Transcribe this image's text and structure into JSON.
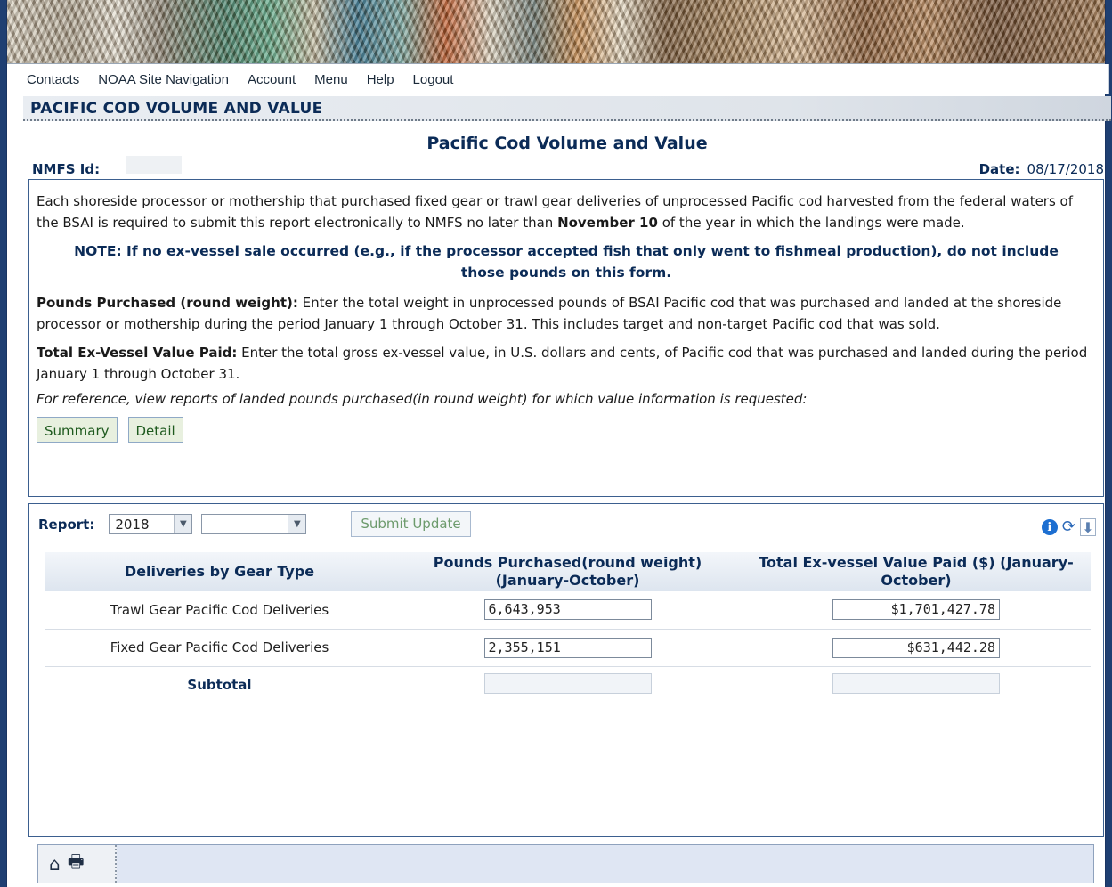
{
  "nav": [
    "Contacts",
    "NOAA Site Navigation",
    "Account",
    "Menu",
    "Help",
    "Logout"
  ],
  "header": {
    "section_title": "PACIFIC COD VOLUME AND VALUE",
    "page_title": "Pacific Cod Volume and Value",
    "nmfs_label": "NMFS Id:",
    "nmfs_value": "",
    "date_label": "Date:",
    "date_value": "08/17/2018"
  },
  "info": {
    "intro_pre": "Each shoreside processor or mothership that purchased fixed gear or trawl gear deliveries of unprocessed Pacific cod harvested from the federal waters of the BSAI is required to submit this report electronically to NMFS no later than ",
    "intro_bold": "November 10",
    "intro_post": " of the year in which the landings were made.",
    "note": "NOTE: If no ex-vessel sale occurred (e.g., if the processor accepted fish that only went to fishmeal production), do not include those pounds on this form.",
    "pounds_label": "Pounds Purchased (round weight):",
    "pounds_text": " Enter the total weight in unprocessed pounds of BSAI Pacific cod that was purchased and landed at the shoreside processor or mothership during the period January 1 through October 31. This includes target and non-target Pacific cod that was sold.",
    "value_label": "Total Ex-Vessel Value Paid:",
    "value_text": " Enter the total gross ex-vessel value, in U.S. dollars and cents, of Pacific cod that was purchased and landed during the period January 1 through October 31.",
    "reference": "For reference, view reports of landed pounds purchased(in round weight) for which value information is requested:",
    "buttons": [
      "Summary",
      "Detail"
    ]
  },
  "report": {
    "label": "Report:",
    "year": "2018",
    "second_select": "",
    "submit_label": "Submit Update",
    "icons": [
      "info-icon",
      "refresh-icon",
      "pin-icon"
    ]
  },
  "table": {
    "columns": [
      "Deliveries by Gear Type",
      "Pounds Purchased(round weight) (January-October)",
      "Total Ex-vessel Value Paid ($) (January-October)"
    ],
    "rows": [
      {
        "type": "Trawl Gear Pacific Cod Deliveries",
        "pounds": "6,643,953",
        "value": "$1,701,427.78"
      },
      {
        "type": "Fixed Gear Pacific Cod Deliveries",
        "pounds": "2,355,151",
        "value": "$631,442.28"
      }
    ],
    "subtotal_label": "Subtotal",
    "subtotal_pounds": "",
    "subtotal_value": ""
  },
  "footer": {
    "icons": [
      "home-icon",
      "print-icon"
    ]
  }
}
